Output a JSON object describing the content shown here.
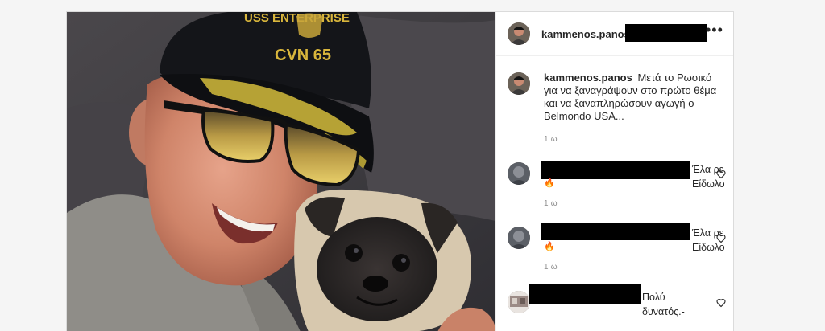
{
  "post": {
    "author": "kammenos.panos",
    "caption_text": "Μετά το Ρωσικό για να ξαναγράψουν στο πρώτο θέμα και να ξαναπληρώσουν αγωγή ο Belmondo USA...",
    "caption_time": "1 ω",
    "more_icon": "•••",
    "photo_cap_text_1": "USS ENTERPRISE",
    "photo_cap_text_2": "CVN 65"
  },
  "comments": [
    {
      "text": "Έλα ρε Είδωλο",
      "emoji": "🔥",
      "time": "1 ω",
      "icon": "heart-outline-icon"
    },
    {
      "text": "Έλα ρε Είδωλο",
      "emoji": "🔥",
      "time": "1 ω",
      "icon": "heart-outline-icon"
    },
    {
      "text": "Πολύ δυνατός.-",
      "icon": "heart-outline-icon"
    }
  ]
}
